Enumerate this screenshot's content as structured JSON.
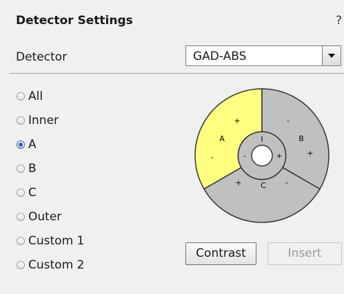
{
  "header": {
    "title": "Detector Settings",
    "help": "?"
  },
  "detector": {
    "label": "Detector",
    "value": "GAD-ABS"
  },
  "radios": [
    {
      "label": "All",
      "checked": false
    },
    {
      "label": "Inner",
      "checked": false
    },
    {
      "label": "A",
      "checked": true
    },
    {
      "label": "B",
      "checked": false
    },
    {
      "label": "C",
      "checked": false
    },
    {
      "label": "Outer",
      "checked": false
    },
    {
      "label": "Custom 1",
      "checked": false
    },
    {
      "label": "Custom 2",
      "checked": false
    }
  ],
  "diagram": {
    "segments": {
      "a": "A",
      "b": "B",
      "c": "C",
      "inner": "I"
    },
    "signs": {
      "plus": "+",
      "minus": "-"
    },
    "colors": {
      "selected": "#ffff80",
      "segment": "#c0c0c0",
      "stroke": "#333333"
    }
  },
  "buttons": {
    "contrast": "Contrast",
    "insert": "Insert"
  }
}
